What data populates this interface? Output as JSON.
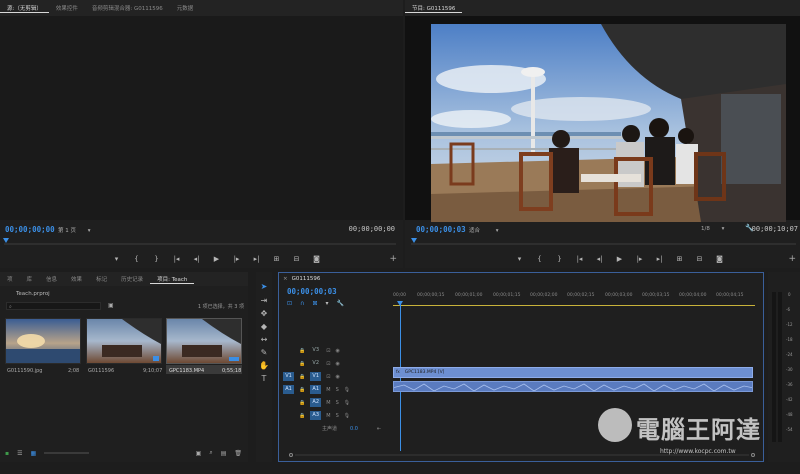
{
  "source_panel": {
    "tabs": [
      "源:（无剪辑）",
      "效果控件",
      "音频剪辑混合器: G0111596",
      "元数据"
    ],
    "timecode_in": "00;00;00;00",
    "page_label": "第 1 页",
    "timecode_out": "00;00;00;00"
  },
  "program_panel": {
    "tab": "节目: G0111596",
    "timecode": "00;00;00;03",
    "fit_label": "适合",
    "resolution": "1/8",
    "duration": "00;00;10;07"
  },
  "transport": {
    "marker": "▾",
    "mark_in": "{",
    "mark_out": "}",
    "go_in": "|◂",
    "step_back": "◂|",
    "play": "▶",
    "step_fwd": "|▸",
    "go_out": "▸|",
    "insert": "⊞",
    "overwrite": "⊟",
    "export_frame": "◙",
    "add": "+"
  },
  "project_panel": {
    "tabs": [
      "项",
      "库",
      "信息",
      "效果",
      "标记",
      "历史记录",
      "项目: Teach"
    ],
    "project_file": "Teach.prproj",
    "selection_info": "1 项已选择，共 3 项",
    "items": [
      {
        "name": "G0111590.jpg",
        "duration": "2;08"
      },
      {
        "name": "G0111596",
        "duration": "9;10;07"
      },
      {
        "name": "GPC1183.MP4",
        "duration": "0;55;18"
      }
    ]
  },
  "sequence": {
    "tab": "G0111596",
    "timecode": "00;00;00;03",
    "ruler": [
      "00;00",
      "00;00;00;15",
      "00;00;01;00",
      "00;00;01;15",
      "00;00;02;00",
      "00;00;02;15",
      "00;00;03;00",
      "00;00;03;15",
      "00;00;04;00",
      "00;00;04;15"
    ],
    "tracks": [
      {
        "patch": "",
        "name": "V3",
        "tog": "◉"
      },
      {
        "patch": "",
        "name": "V2",
        "tog": "◉"
      },
      {
        "patch": "V1",
        "name": "V1",
        "tog": "◉"
      },
      {
        "patch": "A1",
        "name": "A1",
        "tog": "M"
      },
      {
        "patch": "",
        "name": "A2",
        "tog": "M"
      },
      {
        "patch": "",
        "name": "A3",
        "tog": "M"
      }
    ],
    "master_label": "主声道",
    "master_value": "0.0",
    "video_clip": "GPC1183.MP4 [V]",
    "sm_letter": "S"
  },
  "meters": [
    "0",
    "-6",
    "-12",
    "-18",
    "-24",
    "-30",
    "-36",
    "-42",
    "-48",
    "-54"
  ],
  "watermark": {
    "title": "電腦王阿達",
    "url": "http://www.kocpc.com.tw"
  },
  "colors": {
    "accent": "#3b8fe6",
    "clip_video": "#6d8fd1",
    "clip_audio": "#5a7bbf"
  }
}
